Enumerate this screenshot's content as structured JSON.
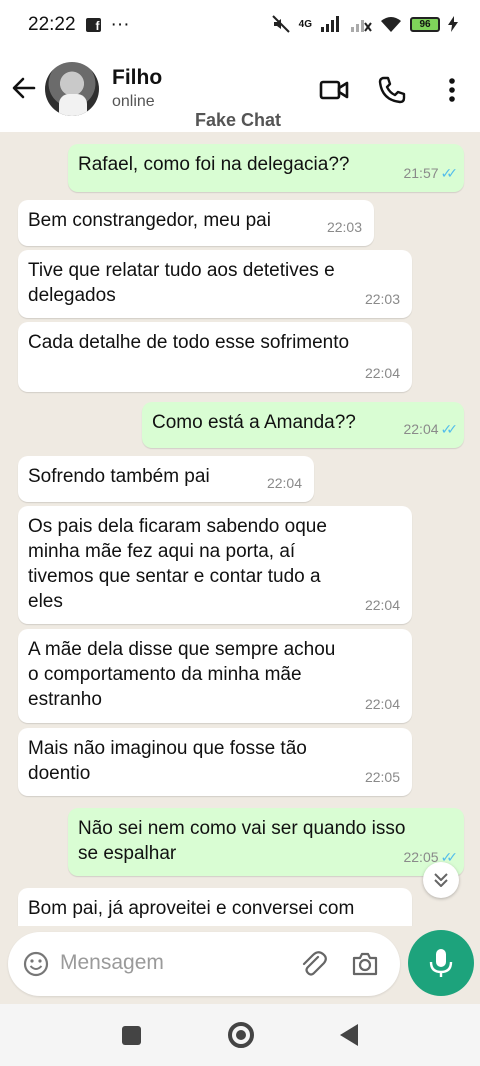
{
  "status_bar": {
    "time": "22:22",
    "overflow": "···",
    "network": "4G",
    "battery": "96"
  },
  "header": {
    "contact_name": "Filho",
    "contact_status": "online",
    "watermark": "Fake Chat"
  },
  "messages": [
    {
      "dir": "out",
      "text": "Rafael, como foi na delegacia??",
      "time": "21:57"
    },
    {
      "dir": "in",
      "text": "Bem constrangedor, meu pai",
      "time": "22:03"
    },
    {
      "dir": "in",
      "text": "Tive que relatar tudo aos detetives e\ndelegados",
      "time": "22:03"
    },
    {
      "dir": "in",
      "text": "Cada detalhe de todo esse sofrimento",
      "time": "22:04"
    },
    {
      "dir": "out",
      "text": "Como está a Amanda??",
      "time": "22:04"
    },
    {
      "dir": "in",
      "text": "Sofrendo também pai",
      "time": "22:04"
    },
    {
      "dir": "in",
      "text": "Os pais dela ficaram sabendo oque\nminha mãe fez aqui na porta, aí\ntivemos que sentar e contar tudo a\neles",
      "time": "22:04"
    },
    {
      "dir": "in",
      "text": "A mãe dela disse que sempre achou\no comportamento da minha mãe\nestranho",
      "time": "22:04"
    },
    {
      "dir": "in",
      "text": "Mais não imaginou que fosse tão\ndoentio",
      "time": "22:05"
    },
    {
      "dir": "out",
      "text": "Não sei nem como vai ser quando isso\nse espalhar",
      "time": "22:05"
    },
    {
      "dir": "in",
      "text": "Bom pai, já aproveitei e conversei com",
      "time": ""
    }
  ],
  "composer": {
    "placeholder": "Mensagem"
  },
  "colors": {
    "chat_bg": "#efeae2",
    "incoming_bubble": "#ffffff",
    "outgoing_bubble": "#d9fdd3",
    "read_tick": "#53bdeb",
    "mic_button": "#1da37c"
  }
}
